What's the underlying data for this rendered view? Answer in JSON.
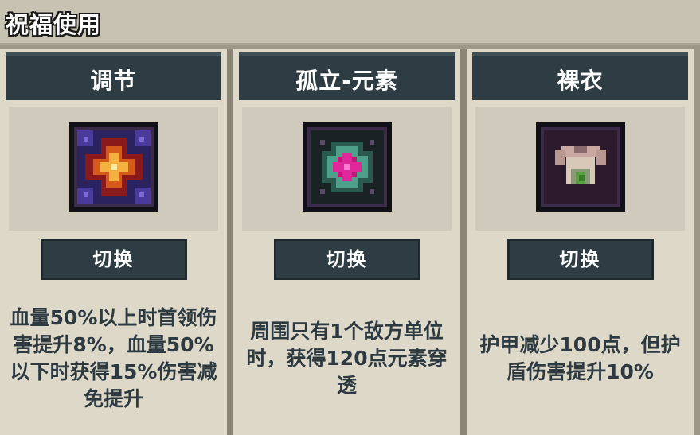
{
  "page": {
    "title": "祝福使用"
  },
  "blessings": [
    {
      "name": "调节",
      "icon": "radiant-star-icon",
      "button_label": "切换",
      "description": "血量50%以上时首领伤害提升8%，血量50%以下时获得15%伤害减免提升"
    },
    {
      "name": "孤立-元素",
      "icon": "element-gem-icon",
      "button_label": "切换",
      "description": "周围只有1个敌方单位时，获得120点元素穿透"
    },
    {
      "name": "裸衣",
      "icon": "bare-shirt-icon",
      "button_label": "切换",
      "description": "护甲减少100点，但护盾伤害提升10%"
    }
  ],
  "colors": {
    "header_bg": "#2e3d44",
    "card_bg": "#ddd8c8",
    "text_dark": "#2d3a41"
  }
}
